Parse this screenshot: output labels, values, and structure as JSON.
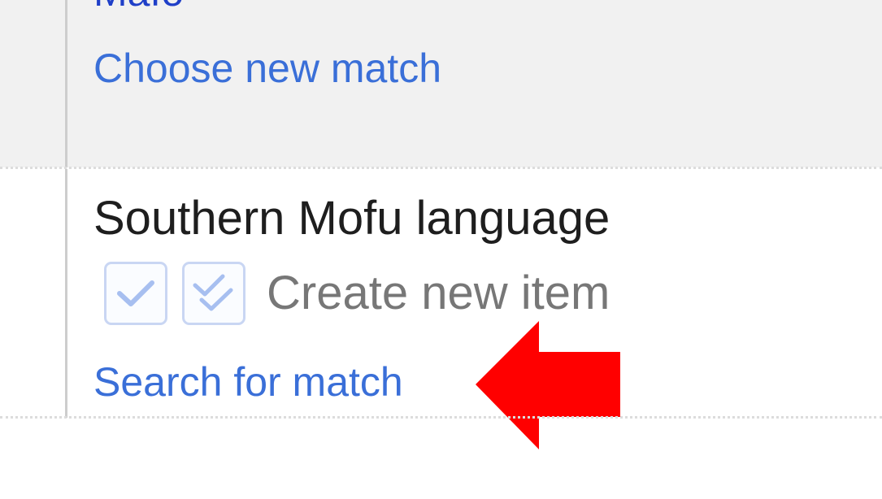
{
  "previous_item": {
    "title_partial": "Mafo",
    "choose_link": "Choose new match"
  },
  "current_item": {
    "title": "Southern Mofu language",
    "create_label": "Create new item",
    "search_link": "Search for match"
  },
  "icons": {
    "check_single": "check-icon",
    "check_double": "double-check-icon",
    "annotation_arrow": "left-arrow-icon"
  },
  "colors": {
    "link": "#3a6fd8",
    "title_partial": "#1f3fc8",
    "arrow": "#ff0000",
    "row_bg": "#f1f1f1"
  }
}
